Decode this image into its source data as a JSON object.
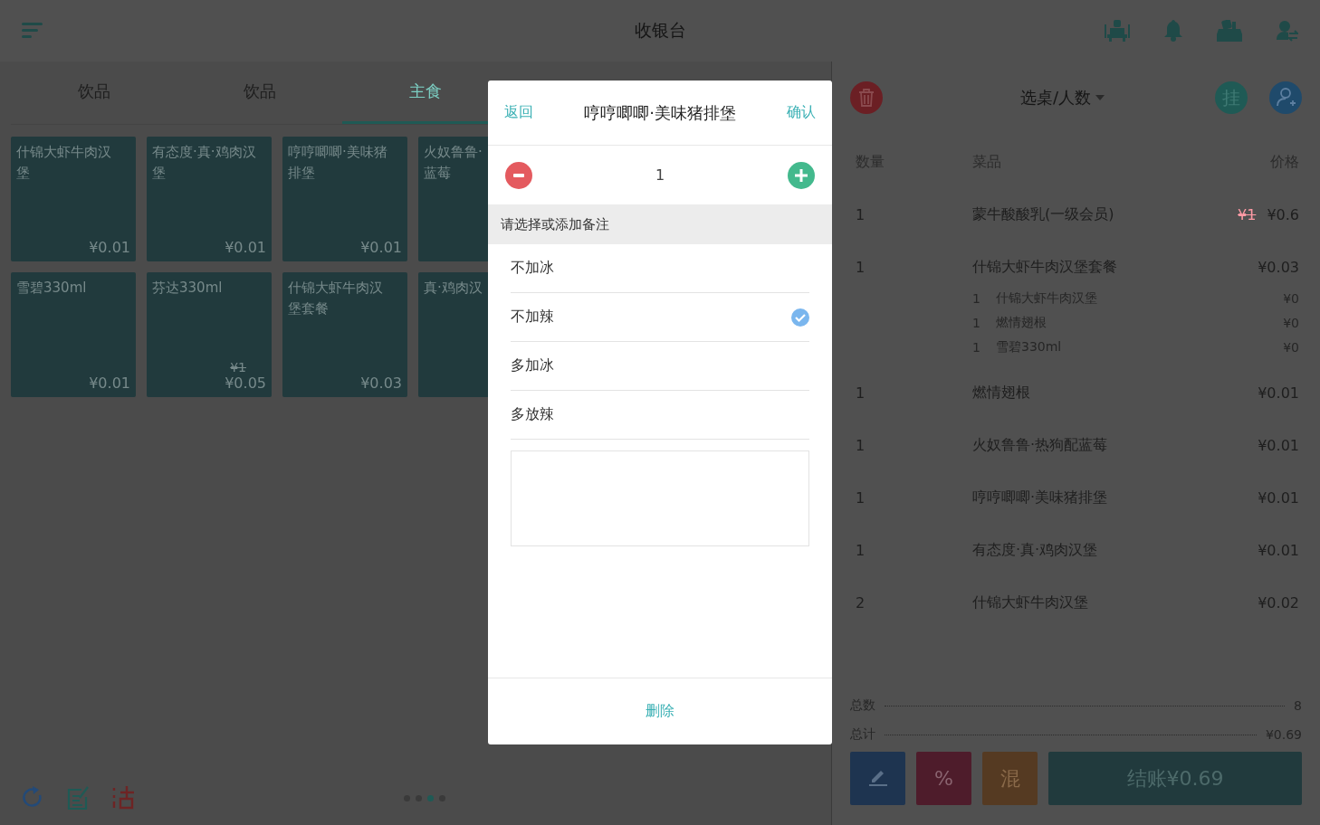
{
  "header": {
    "title": "收银台"
  },
  "tabs": [
    {
      "label": "饮品",
      "selected": false
    },
    {
      "label": "饮品",
      "selected": false
    },
    {
      "label": "主食",
      "selected": true
    }
  ],
  "cards": [
    {
      "lines": [
        "什锦大虾牛肉汉",
        "堡"
      ],
      "price": "¥0.01"
    },
    {
      "lines": [
        "有态度·真·鸡肉汉",
        "堡"
      ],
      "price": "¥0.01"
    },
    {
      "lines": [
        "哼哼唧唧·美味猪",
        "排堡"
      ],
      "price": "¥0.01"
    },
    {
      "lines": [
        "火奴鲁鲁·",
        "蓝莓"
      ]
    },
    {
      "lines": [
        "雪碧330ml"
      ],
      "price": "¥0.01"
    },
    {
      "lines": [
        "芬达330ml"
      ],
      "original_price": "¥1",
      "price": "¥0.05"
    },
    {
      "lines": [
        "什锦大虾牛肉汉",
        "堡套餐"
      ],
      "price": "¥0.03"
    },
    {
      "lines": [
        "真·鸡肉汉"
      ]
    }
  ],
  "pager": [
    {
      "selected": false
    },
    {
      "selected": false
    },
    {
      "selected": true
    },
    {
      "selected": false
    }
  ],
  "cart": {
    "table_label": "选桌/人数",
    "hold_label": "挂",
    "columns": [
      "数量",
      "菜品",
      "价格"
    ],
    "rows": [
      {
        "qty": "1",
        "name": "蒙牛酸酸乳(一级会员)",
        "original_price": "¥1",
        "price": "¥0.6"
      },
      {
        "qty": "1",
        "name": "什锦大虾牛肉汉堡套餐",
        "price": "¥0.03",
        "children": [
          {
            "qty": "1",
            "name": "什锦大虾牛肉汉堡",
            "price": "¥0"
          },
          {
            "qty": "1",
            "name": "燃情翅根",
            "price": "¥0"
          },
          {
            "qty": "1",
            "name": "雪碧330ml",
            "price": "¥0"
          }
        ]
      },
      {
        "qty": "1",
        "name": "燃情翅根",
        "price": "¥0.01"
      },
      {
        "qty": "1",
        "name": "火奴鲁鲁·热狗配蓝莓",
        "price": "¥0.01"
      },
      {
        "qty": "1",
        "name": "哼哼唧唧·美味猪排堡",
        "price": "¥0.01"
      },
      {
        "qty": "1",
        "name": "有态度·真·鸡肉汉堡",
        "price": "¥0.01"
      },
      {
        "qty": "2",
        "name": "什锦大虾牛肉汉堡",
        "price": "¥0.02"
      }
    ],
    "totals": [
      {
        "label": "总数",
        "value": "8"
      },
      {
        "label": "总计",
        "value": "¥0.69"
      }
    ],
    "actions": [
      {
        "kind": "edit"
      },
      {
        "kind": "discount",
        "label": "%"
      },
      {
        "kind": "mixed",
        "label": "混"
      },
      {
        "kind": "checkout",
        "label": "结账¥0.69"
      }
    ]
  },
  "dialog": {
    "back": "返回",
    "title": "哼哼唧唧·美味猪排堡",
    "confirm": "确认",
    "quantity": "1",
    "remark_heading": "请选择或添加备注",
    "options": [
      {
        "label": "不加冰",
        "checked": false
      },
      {
        "label": "不加辣",
        "checked": true
      },
      {
        "label": "多加冰",
        "checked": false
      },
      {
        "label": "多放辣",
        "checked": false
      }
    ],
    "delete": "删除"
  }
}
